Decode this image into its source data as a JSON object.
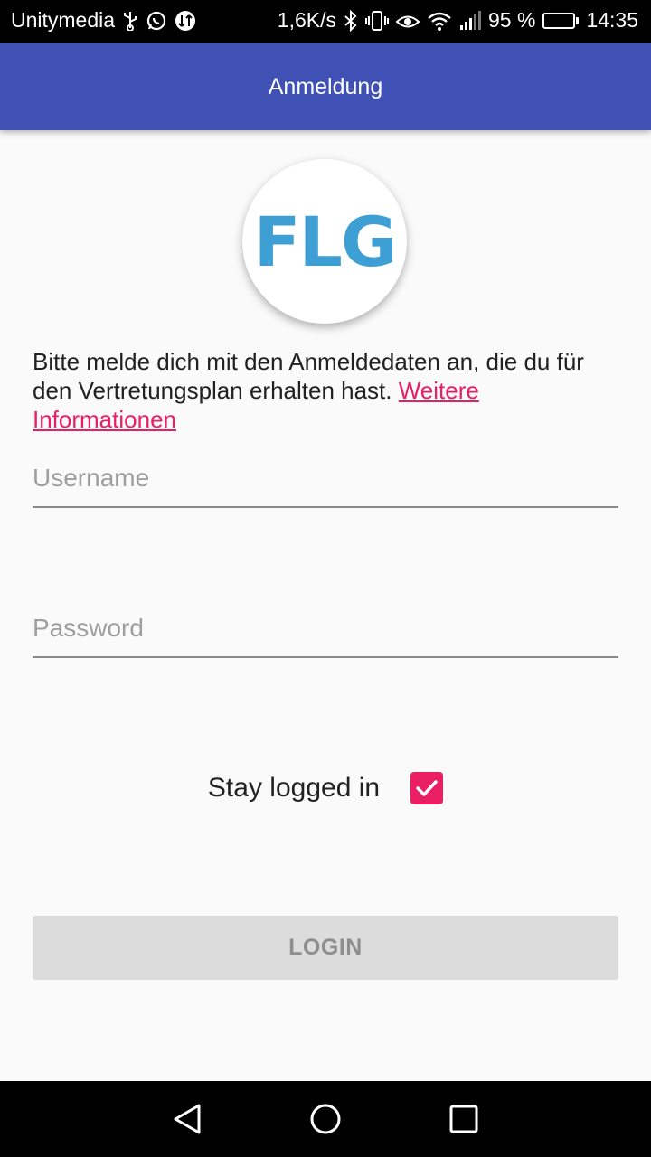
{
  "status_bar": {
    "carrier": "Unitymedia",
    "speed": "1,6K/s",
    "battery_text": "95 %",
    "battery_level": 0.95,
    "time": "14:35"
  },
  "app_bar": {
    "title": "Anmeldung"
  },
  "logo": {
    "text": "FLG",
    "color": "#3d9fd4"
  },
  "info": {
    "text": "Bitte melde dich mit den Anmeldedaten an, die du für den Vertretungsplan erhalten hast. ",
    "link": "Weitere Informationen",
    "link_color": "#e91e63"
  },
  "form": {
    "username_placeholder": "Username",
    "password_placeholder": "Password",
    "stay_label": "Stay logged in",
    "stay_checked": true,
    "checkbox_color": "#e91e63",
    "login_label": "LOGIN"
  },
  "nav_bar": {
    "icons": [
      "back-icon",
      "home-icon",
      "recents-icon"
    ]
  },
  "colors": {
    "primary": "#3f51b5",
    "accent": "#e91e63"
  }
}
